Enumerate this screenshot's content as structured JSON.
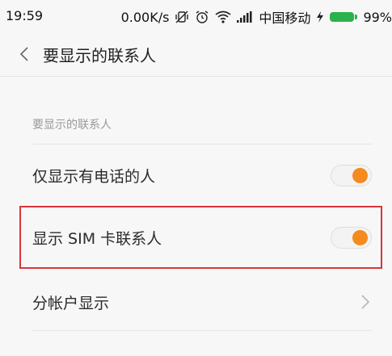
{
  "status_bar": {
    "time": "19:59",
    "net_speed": "0.00K/s",
    "carrier": "中国移动",
    "battery_level": "99%",
    "icons": [
      "vibrate-off-icon",
      "alarm-icon",
      "wifi-icon",
      "signal-icon",
      "charging-icon",
      "battery-icon"
    ],
    "battery_color": "#2bb24c"
  },
  "header": {
    "back_icon": "chevron-left-icon",
    "title": "要显示的联系人"
  },
  "section": {
    "header": "要显示的联系人"
  },
  "rows": [
    {
      "label": "仅显示有电话的人",
      "control": "toggle",
      "on": true
    },
    {
      "label": "显示 SIM 卡联系人",
      "control": "toggle",
      "on": true,
      "highlighted": true
    },
    {
      "label": "分帐户显示",
      "control": "chevron-right-icon"
    }
  ],
  "colors": {
    "accent": "#f58a1f",
    "highlight_border": "#d9353b",
    "background": "#f7f7f7"
  }
}
